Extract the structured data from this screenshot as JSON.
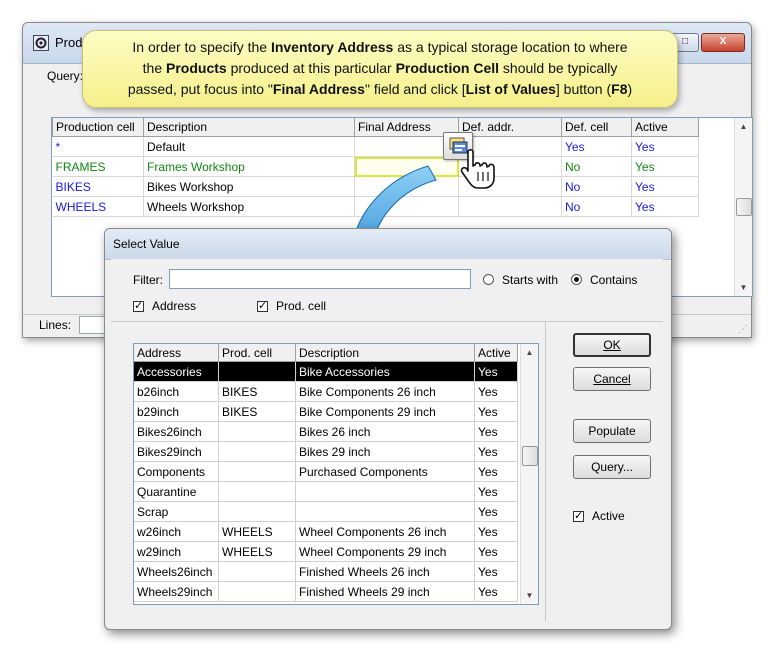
{
  "bg_window": {
    "title": "Prod",
    "query_label": "Query:",
    "win_buttons": [
      "_",
      "□",
      "X"
    ],
    "grid": {
      "headers": [
        "Production cell",
        "Description",
        "Final Address",
        "Def. addr.",
        "Def. cell",
        "Active"
      ],
      "rows": [
        {
          "cell": "*",
          "description": "Default",
          "final": "",
          "def_addr": "",
          "def_cell": "Yes",
          "active": "Yes"
        },
        {
          "cell": "FRAMES",
          "description": "Frames Workshop",
          "final": "",
          "def_addr": "",
          "def_cell": "No",
          "active": "Yes"
        },
        {
          "cell": "BIKES",
          "description": "Bikes Workshop",
          "final": "",
          "def_addr": "",
          "def_cell": "No",
          "active": "Yes"
        },
        {
          "cell": "WHEELS",
          "description": "Wheels Workshop",
          "final": "",
          "def_addr": "",
          "def_cell": "No",
          "active": "Yes"
        }
      ]
    },
    "status": {
      "lines_label": "Lines:"
    }
  },
  "callout": {
    "line1_a": "In order to specify the ",
    "line1_b": "Inventory Address",
    "line1_c": " as a typical storage location to where",
    "line2_a": "the ",
    "line2_b": "Products",
    "line2_c": " produced at this particular ",
    "line2_d": "Production  Cell",
    "line2_e": " should be typically",
    "line3_a": "passed, put focus into \"",
    "line3_b": "Final Address",
    "line3_c": "\" field and click [",
    "line3_d": "List of Values",
    "line3_e": "] button (",
    "line3_f": "F8",
    "line3_g": ")"
  },
  "dialog": {
    "title": "Select Value",
    "filter_label": "Filter:",
    "filter_value": "",
    "starts_with_label": "Starts with",
    "contains_label": "Contains",
    "address_label": "Address",
    "prod_cell_label": "Prod. cell",
    "grid": {
      "headers": [
        "Address",
        "Prod. cell",
        "Description",
        "Active"
      ],
      "rows": [
        {
          "address": "Accessories",
          "cell": "",
          "description": "Bike Accessories",
          "active": "Yes"
        },
        {
          "address": "b26inch",
          "cell": "BIKES",
          "description": "Bike Components 26 inch",
          "active": "Yes"
        },
        {
          "address": "b29inch",
          "cell": "BIKES",
          "description": "Bike Components 29 inch",
          "active": "Yes"
        },
        {
          "address": "Bikes26inch",
          "cell": "",
          "description": "Bikes 26 inch",
          "active": "Yes"
        },
        {
          "address": "Bikes29inch",
          "cell": "",
          "description": "Bikes 29 inch",
          "active": "Yes"
        },
        {
          "address": "Components",
          "cell": "",
          "description": "Purchased Components",
          "active": "Yes"
        },
        {
          "address": "Quarantine",
          "cell": "",
          "description": "",
          "active": "Yes"
        },
        {
          "address": "Scrap",
          "cell": "",
          "description": "",
          "active": "Yes"
        },
        {
          "address": "w26inch",
          "cell": "WHEELS",
          "description": "Wheel Components 26 inch",
          "active": "Yes"
        },
        {
          "address": "w29inch",
          "cell": "WHEELS",
          "description": "Wheel Components 29 inch",
          "active": "Yes"
        },
        {
          "address": "Wheels26inch",
          "cell": "",
          "description": "Finished Wheels 26 inch",
          "active": "Yes"
        },
        {
          "address": "Wheels29inch",
          "cell": "",
          "description": "Finished Wheels 29 inch",
          "active": "Yes"
        }
      ]
    },
    "buttons": {
      "ok": "OK",
      "cancel": "Cancel",
      "populate": "Populate",
      "query": "Query..."
    },
    "active_label": "Active",
    "check_mark": "✓",
    "scroll_up": "▲",
    "scroll_down": "▼"
  },
  "icons": {
    "app": "gear-app-icon",
    "lov": "list-of-values-icon",
    "cursor": "hand-pointer-icon",
    "arrow": "curved-arrow-icon"
  }
}
